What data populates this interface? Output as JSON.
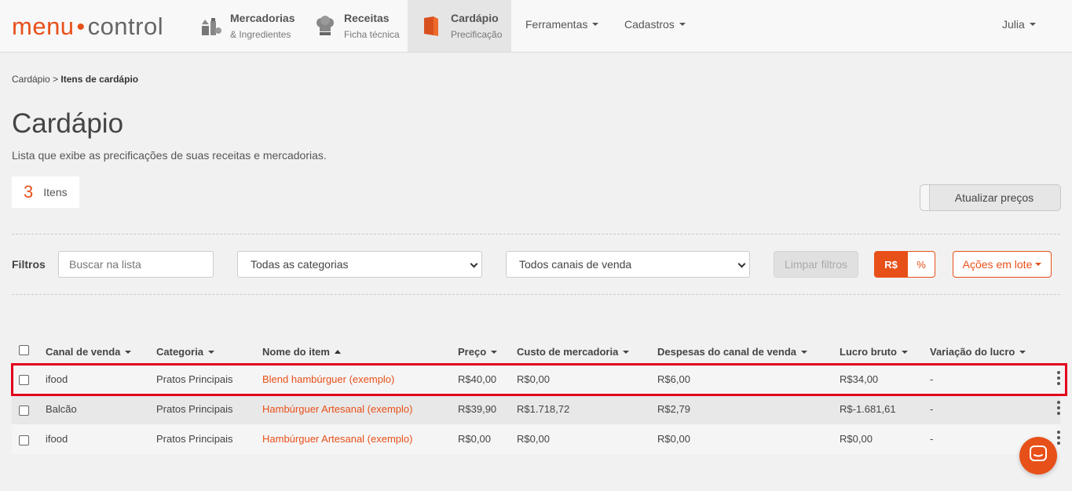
{
  "brand": {
    "part1": "menu",
    "part2": "control",
    "accent": "#e8501a"
  },
  "nav": {
    "mercadorias": {
      "title": "Mercadorias",
      "subtitle": "& Ingredientes",
      "icon": "ingredients-icon"
    },
    "receitas": {
      "title": "Receitas",
      "subtitle": "Ficha técnica",
      "icon": "chef-hat-icon"
    },
    "cardapio": {
      "title": "Cardápio",
      "subtitle": "Precificação",
      "icon": "menu-book-icon"
    },
    "ferramentas": "Ferramentas",
    "cadastros": "Cadastros",
    "user": "Julia"
  },
  "breadcrumb": {
    "parent": "Cardápio",
    "separator": ">",
    "current": "Itens de cardápio"
  },
  "page": {
    "title": "Cardápio",
    "description": "Lista que exibe as precificações de suas receitas e mercadorias.",
    "count": "3",
    "count_label": "Itens",
    "update_button": "Atualizar preços"
  },
  "filters": {
    "label": "Filtros",
    "search_placeholder": "Buscar na lista",
    "category_select": "Todas as categorias",
    "channel_select": "Todos canais de venda",
    "clear_button": "Limpar filtros",
    "toggle_currency": "R$",
    "toggle_percent": "%",
    "batch_button": "Ações em lote"
  },
  "table": {
    "columns": [
      "Canal de venda",
      "Categoria",
      "Nome do item",
      "Preço",
      "Custo de mercadoria",
      "Despesas do canal de venda",
      "Lucro bruto",
      "Variação do lucro"
    ],
    "rows": [
      [
        "ifood",
        "Pratos Principais",
        "Blend hambúrguer (exemplo)",
        "R$40,00",
        "R$0,00",
        "R$6,00",
        "R$34,00",
        "-"
      ],
      [
        "Balcão",
        "Pratos Principais",
        "Hambúrguer Artesanal (exemplo)",
        "R$39,90",
        "R$1.718,72",
        "R$2,79",
        "R$-1.681,61",
        "-"
      ],
      [
        "ifood",
        "Pratos Principais",
        "Hambúrguer Artesanal (exemplo)",
        "R$0,00",
        "R$0,00",
        "R$0,00",
        "R$0,00",
        "-"
      ]
    ]
  }
}
